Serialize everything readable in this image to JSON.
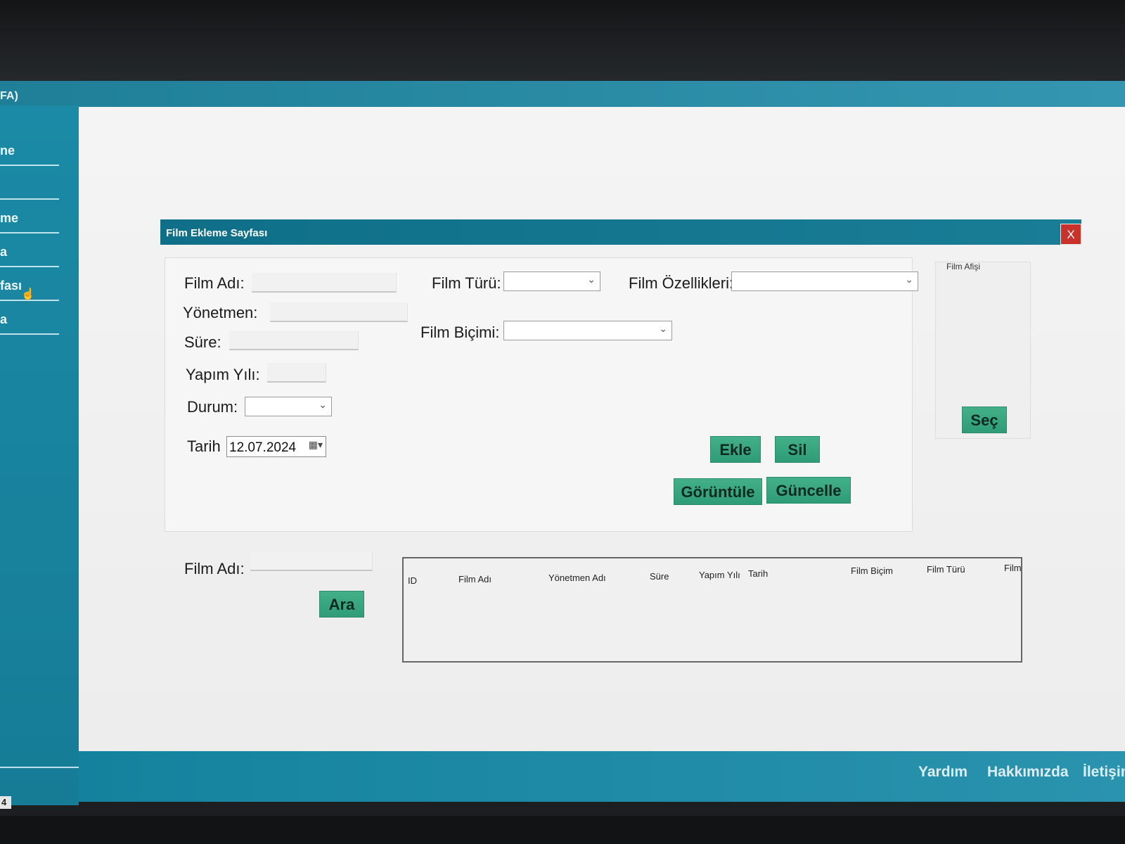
{
  "window": {
    "title_fragment": "FA)"
  },
  "sidebar": {
    "items": [
      {
        "label": "ne"
      },
      {
        "label": ""
      },
      {
        "label": "me"
      },
      {
        "label": "a"
      },
      {
        "label": "fası"
      },
      {
        "label": "a"
      }
    ],
    "page_indicator": "4"
  },
  "dialog": {
    "title": "Film Ekleme Sayfası",
    "close_label": "X"
  },
  "form": {
    "film_adi_label": "Film Adı:",
    "film_adi_value": "",
    "yonetmen_label": "Yönetmen:",
    "yonetmen_value": "",
    "sure_label": "Süre:",
    "sure_value": "",
    "yapim_yili_label": "Yapım Yılı:",
    "yapim_yili_value": "",
    "durum_label": "Durum:",
    "durum_value": "",
    "tarih_label": "Tarih",
    "tarih_value": "12.07.2024",
    "film_turu_label": "Film Türü:",
    "film_turu_value": "",
    "film_bicimi_label": "Film Biçimi:",
    "film_bicimi_value": "",
    "film_ozellikleri_label": "Film Özellikleri:",
    "film_ozellikleri_value": ""
  },
  "actions": {
    "ekle": "Ekle",
    "sil": "Sil",
    "goruntule": "Görüntüle",
    "guncelle": "Güncelle"
  },
  "poster": {
    "label": "Film Afişi",
    "select_button": "Seç"
  },
  "search": {
    "film_adi_label": "Film Adı:",
    "film_adi_value": "",
    "search_button": "Ara"
  },
  "table": {
    "columns": [
      "ID",
      "Film Adı",
      "Yönetmen Adı",
      "Süre",
      "Yapım Yılı",
      "Tarih",
      "Film Biçim",
      "Film Türü",
      "Film"
    ],
    "rows": []
  },
  "footer": {
    "links": [
      "Yardım",
      "Hakkımızda",
      "İletişim"
    ]
  },
  "colors": {
    "accent": "#1b8aa6",
    "dialog_title_bg": "#0f6f88",
    "button_green": "#3aa882",
    "close_red": "#c8322a"
  },
  "icons": {
    "close": "close-icon",
    "dropdown": "chevron-down-icon",
    "calendar": "calendar-icon",
    "cursor": "hand-cursor-icon"
  }
}
